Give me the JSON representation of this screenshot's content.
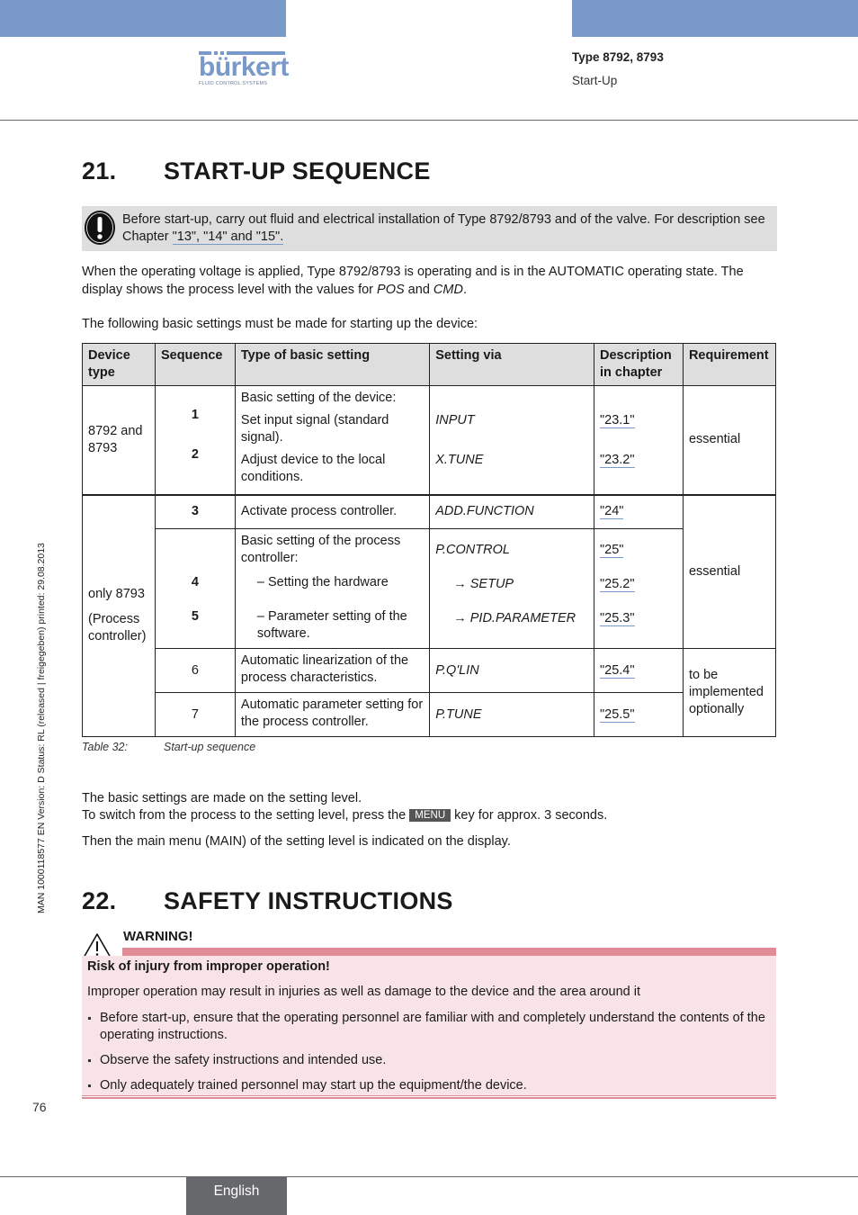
{
  "header": {
    "brand": "bürkert",
    "brand_sub": "FLUID CONTROL SYSTEMS",
    "type": "Type 8792, 8793",
    "section": "Start-Up"
  },
  "side_text": "MAN  1000118577  EN  Version: D  Status: RL (released | freigegeben)  printed: 29.08.2013",
  "section21": {
    "number": "21.",
    "title": "START-UP SEQUENCE",
    "note_text": "Before start-up, carry out fluid and electrical installation of Type 8792/8793 and of the valve. For description see Chapter ",
    "note_link": "\"13\", \"14\" and \"15\".",
    "para1_a": "When the operating voltage is applied, Type 8792/8793 is operating and is in the AUTOMATIC operating state. The display shows the process level with the values for ",
    "para1_pos": "POS",
    "para1_and": " and ",
    "para1_cmd": "CMD",
    "para1_end": ".",
    "para2": "The following basic settings must be made for starting up the device:"
  },
  "table": {
    "headers": [
      "Device type",
      "Sequence",
      "Type of basic setting",
      "Setting via",
      "Description in chapter",
      "Requirement"
    ],
    "group1": {
      "device": "8792 and 8793",
      "intro": "Basic setting of the device:",
      "rows": [
        {
          "seq": "1",
          "setting": "Set input signal (standard signal).",
          "via": "INPUT",
          "chapter": "\"23.1\""
        },
        {
          "seq": "2",
          "setting": "Adjust device to the local conditions.",
          "via": "X.TUNE",
          "chapter": "\"23.2\""
        }
      ],
      "requirement": "essential"
    },
    "group2": {
      "device_line1": "only 8793",
      "device_line2": "(Process controller)",
      "row3": {
        "seq": "3",
        "setting": "Activate process controller.",
        "via": "ADD.FUNCTION",
        "chapter": "\"24\""
      },
      "row45": {
        "intro": "Basic setting of the process controller:",
        "via_intro": "P.CONTROL",
        "chapter_intro": "\"25\"",
        "items": [
          {
            "seq": "4",
            "setting": "– Setting the hardware",
            "via": "→ SETUP",
            "chapter": "\"25.2\""
          },
          {
            "seq": "5",
            "setting": "– Parameter setting of the software.",
            "via": "→ PID.PARAMETER",
            "chapter": "\"25.3\""
          }
        ]
      },
      "requirement_essential": "essential",
      "row6": {
        "seq": "6",
        "setting": "Automatic linearization of the process characteristics.",
        "via": "P.Q'LIN",
        "chapter": "\"25.4\""
      },
      "row7": {
        "seq": "7",
        "setting": "Automatic parameter setting for the process controller.",
        "via": "P.TUNE",
        "chapter": "\"25.5\""
      },
      "requirement_optional": "to be implemented optionally"
    },
    "caption_label": "Table 32:",
    "caption_text": "Start-up sequence"
  },
  "after_table": {
    "line1": "The basic settings are made on the setting level.",
    "line2_a": "To switch from the process to the setting level, press the ",
    "menu_key": "MENU",
    "line2_b": " key for approx. 3 seconds.",
    "line3": "Then the main menu (MAIN) of the setting level is indicated on the display."
  },
  "section22": {
    "number": "22.",
    "title": "SAFETY INSTRUCTIONS",
    "warning_title": "WARNING!",
    "risk": "Risk of injury from improper operation!",
    "description": "Improper operation may result in injuries as well as damage to the device and the area around it",
    "bullets": [
      "Before start-up, ensure that the operating personnel are familiar with and completely understand the contents of the operating instructions.",
      "Observe the safety instructions and intended use.",
      "Only adequately trained personnel may start up the equipment/the device."
    ]
  },
  "footer": {
    "page_number": "76",
    "language": "English"
  },
  "colors": {
    "brand_blue": "#7899c9",
    "warning_red": "#e08b96",
    "warning_bg": "#f8e4e6",
    "note_bg": "#dedede",
    "footer_tab": "#66686b"
  }
}
